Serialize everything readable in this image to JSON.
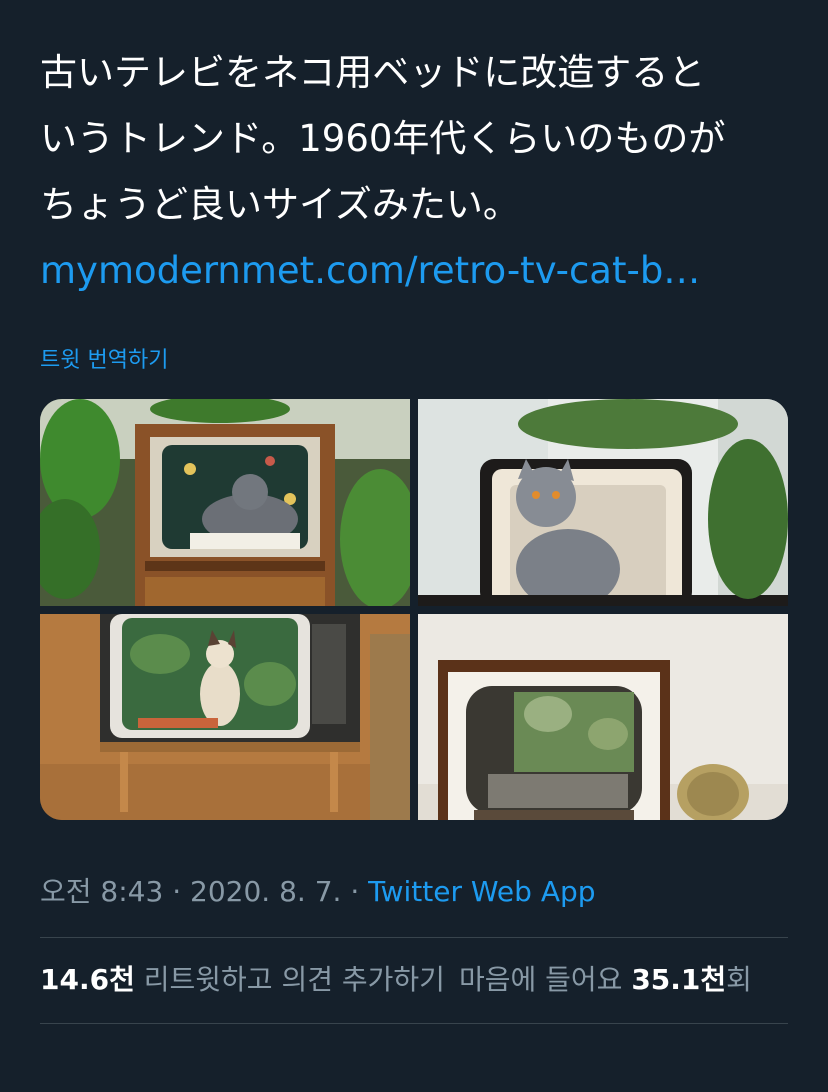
{
  "tweet": {
    "lines": [
      "古いテレビをネコ用ベッドに改造すると",
      "いうトレンド。1960年代くらいのものが",
      "ちょうど良いサイズみたい。"
    ],
    "link": "mymodernmet.com/retro-tv-cat-b…"
  },
  "translate_label": "트윗 번역하기",
  "media": {
    "images": [
      "cat in vintage wooden TV console with floral backdrop and plants",
      "gray cat sitting in dark retro TV frame with houseplants",
      "siamese cat in retro TV on wooden legs with tropical leaf backdrop",
      "walnut TV-shaped cat bed with palm leaf interior and cactus"
    ]
  },
  "meta": {
    "time": "오전 8:43",
    "sep1": "·",
    "date": "2020. 8. 7.",
    "sep2": "·",
    "source": "Twitter Web App"
  },
  "stats": {
    "retweet_count": "14.6천",
    "retweet_label": "리트윗하고 의견 추가하기",
    "likes_label": "마음에 들어요",
    "likes_count": "35.1천",
    "likes_suffix": "회"
  },
  "colors": {
    "background": "#15202b",
    "link": "#1d9bf0",
    "secondary_text": "#8899a6",
    "divider": "#38444d"
  }
}
